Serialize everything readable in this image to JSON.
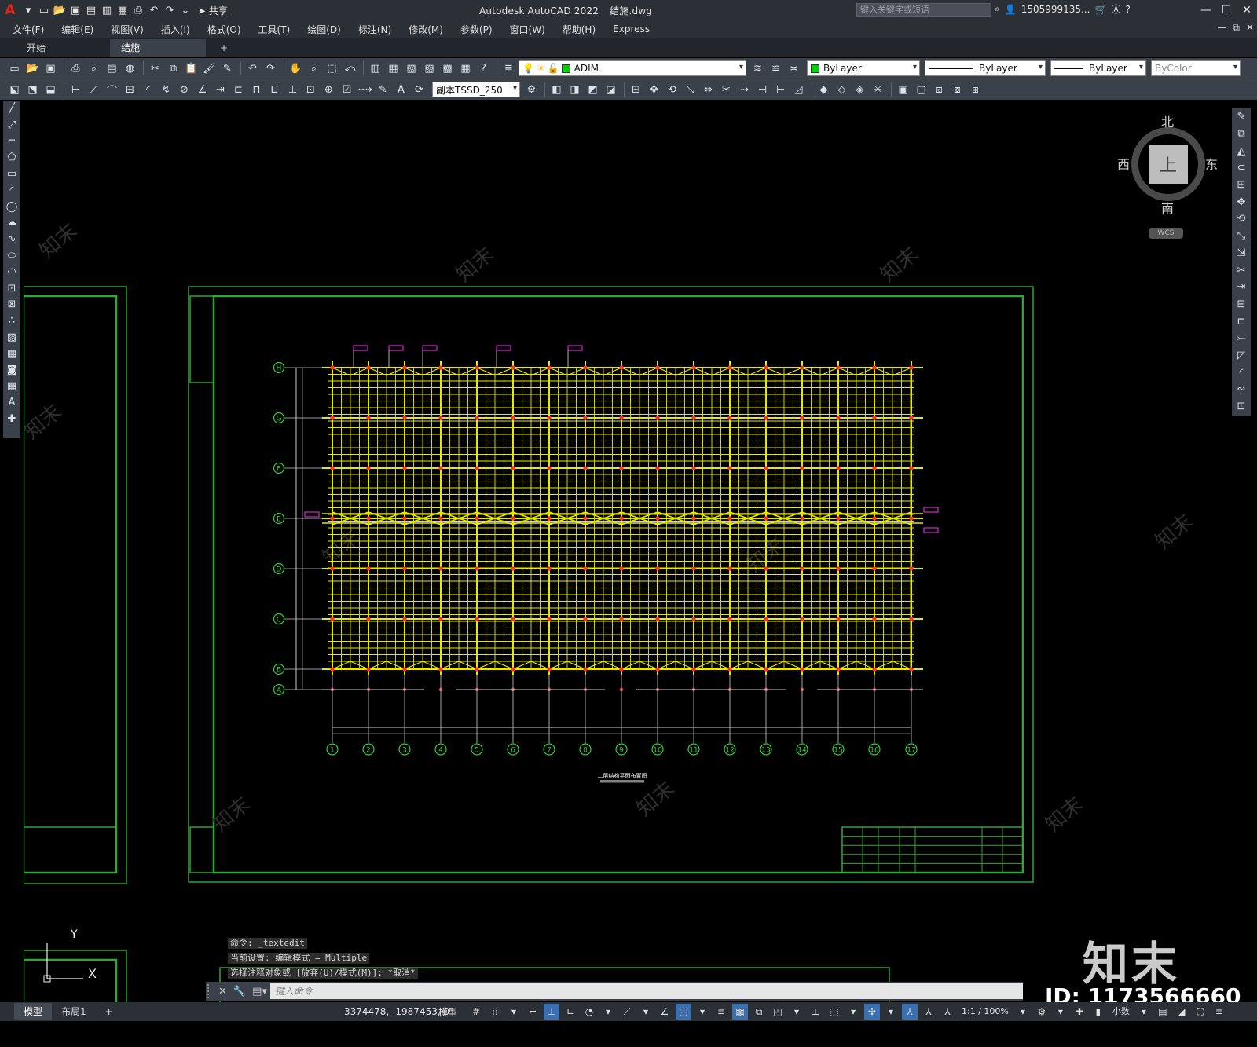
{
  "app": {
    "title": "Autodesk AutoCAD 2022",
    "file": "结施.dwg",
    "share_label": "共享",
    "search_placeholder": "键入关键字或短语",
    "user": "1505999135...",
    "colors": {
      "chrome": "#2b2f36",
      "toolbar": "#3b414a",
      "grid": "#e8e800",
      "frame": "#2fa82f",
      "accent": "#3a6fb0",
      "logo": "#e2231a"
    }
  },
  "menu": [
    "文件(F)",
    "编辑(E)",
    "视图(V)",
    "插入(I)",
    "格式(O)",
    "工具(T)",
    "绘图(D)",
    "标注(N)",
    "修改(M)",
    "参数(P)",
    "窗口(W)",
    "帮助(H)",
    "Express"
  ],
  "tabs": [
    {
      "label": "开始",
      "active": false
    },
    {
      "label": "结施*",
      "active": true
    }
  ],
  "props": {
    "layer": "ADIM",
    "color": "ByLayer",
    "linetype": "ByLayer",
    "lineweight": "ByLayer",
    "plotstyle": "ByColor",
    "text_style": "副本TSSD_250"
  },
  "viewcube": {
    "north": "北",
    "south": "南",
    "west": "西",
    "east": "东",
    "face": "上",
    "wcs": "WCS"
  },
  "ucs": {
    "x": "X",
    "y": "Y"
  },
  "command": {
    "history": [
      "命令: _textedit",
      "当前设置: 编辑模式 = Multiple",
      "选择注释对象或 [放弃(U)/模式(M)]: *取消*"
    ],
    "placeholder": "键入命令"
  },
  "status": {
    "coords": "3374478, -1987453, 0",
    "model_label": "模型",
    "layout_tabs": [
      "模型",
      "布局1"
    ],
    "scale": "1:1 / 100%",
    "units": "小数"
  },
  "drawing": {
    "row_axes": [
      "H",
      "G",
      "F",
      "E",
      "D",
      "C",
      "B",
      "A"
    ],
    "col_axes": [
      "1",
      "2",
      "3",
      "4",
      "5",
      "6",
      "7",
      "8",
      "9",
      "10",
      "11",
      "12",
      "13",
      "14",
      "15",
      "16",
      "17"
    ],
    "title_bottom": "二层结构平面布置图"
  },
  "watermark": {
    "logo": "知末",
    "id": "ID: 1173566660"
  }
}
